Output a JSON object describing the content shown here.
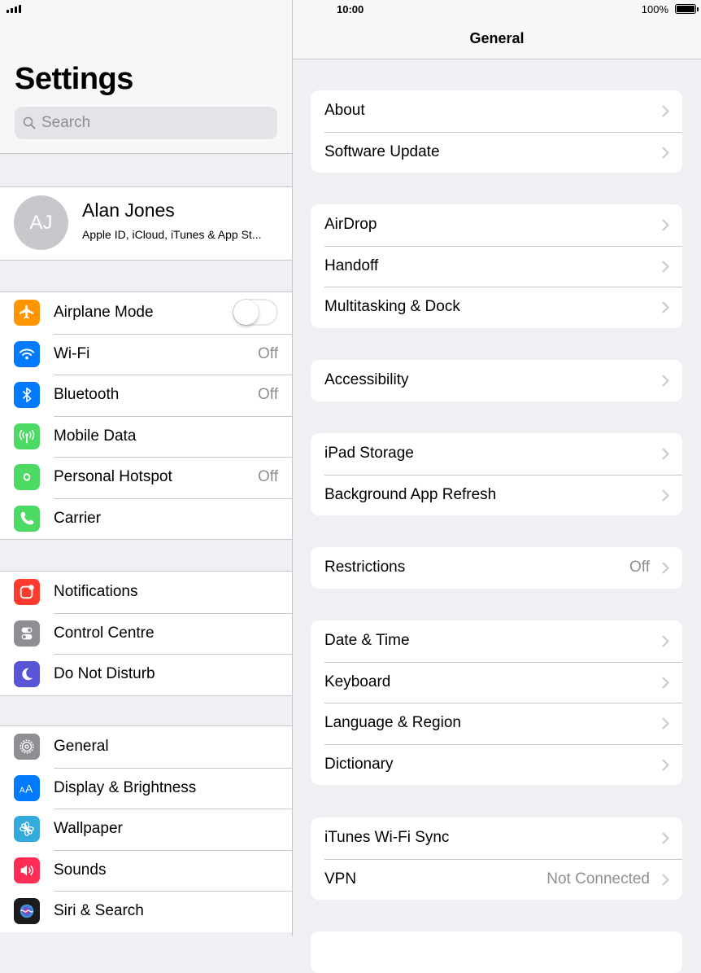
{
  "status_bar": {
    "time": "10:00",
    "battery": "100%"
  },
  "sidebar": {
    "title": "Settings",
    "search_placeholder": "Search",
    "profile": {
      "initials": "AJ",
      "name": "Alan Jones",
      "subtitle": "Apple ID, iCloud, iTunes & App St..."
    },
    "groups": [
      [
        {
          "label": "Airplane Mode",
          "icon": "airplane-icon",
          "color": "#ff9500",
          "toggle": false
        },
        {
          "label": "Wi-Fi",
          "icon": "wifi-icon",
          "color": "#007aff",
          "value": "Off"
        },
        {
          "label": "Bluetooth",
          "icon": "bluetooth-icon",
          "color": "#007aff",
          "value": "Off"
        },
        {
          "label": "Mobile Data",
          "icon": "antenna-icon",
          "color": "#4cd964"
        },
        {
          "label": "Personal Hotspot",
          "icon": "hotspot-icon",
          "color": "#4cd964",
          "value": "Off"
        },
        {
          "label": "Carrier",
          "icon": "phone-icon",
          "color": "#4cd964"
        }
      ],
      [
        {
          "label": "Notifications",
          "icon": "notifications-icon",
          "color": "#ff3b30"
        },
        {
          "label": "Control Centre",
          "icon": "control-centre-icon",
          "color": "#8e8e93"
        },
        {
          "label": "Do Not Disturb",
          "icon": "moon-icon",
          "color": "#5856d6"
        }
      ],
      [
        {
          "label": "General",
          "icon": "gear-icon",
          "color": "#8e8e93"
        },
        {
          "label": "Display & Brightness",
          "icon": "text-size-icon",
          "color": "#007aff"
        },
        {
          "label": "Wallpaper",
          "icon": "flower-icon",
          "color": "#34aadc"
        },
        {
          "label": "Sounds",
          "icon": "speaker-icon",
          "color": "#ff2d55"
        },
        {
          "label": "Siri & Search",
          "icon": "siri-icon",
          "color": "#1c1c1e"
        }
      ]
    ]
  },
  "detail": {
    "title": "General",
    "sections": [
      [
        {
          "label": "About"
        },
        {
          "label": "Software Update"
        }
      ],
      [
        {
          "label": "AirDrop"
        },
        {
          "label": "Handoff"
        },
        {
          "label": "Multitasking & Dock"
        }
      ],
      [
        {
          "label": "Accessibility"
        }
      ],
      [
        {
          "label": "iPad Storage"
        },
        {
          "label": "Background App Refresh"
        }
      ],
      [
        {
          "label": "Restrictions",
          "value": "Off"
        }
      ],
      [
        {
          "label": "Date & Time"
        },
        {
          "label": "Keyboard"
        },
        {
          "label": "Language & Region"
        },
        {
          "label": "Dictionary"
        }
      ],
      [
        {
          "label": "iTunes Wi-Fi Sync"
        },
        {
          "label": "VPN",
          "value": "Not Connected"
        }
      ],
      [
        {
          "label": ""
        }
      ]
    ]
  }
}
